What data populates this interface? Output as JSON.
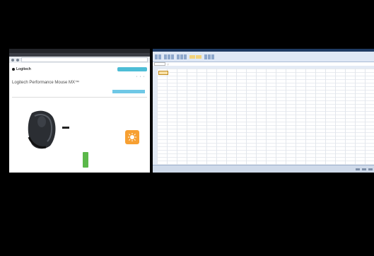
{
  "left_window": {
    "address": "",
    "site": {
      "logo_text": "Logitech",
      "nav": [
        "",
        "",
        ""
      ],
      "search_placeholder": "",
      "product_title": "Logitech Performance Mouse MX™",
      "product_sub": "",
      "cta_label": "",
      "tabs": [
        "",
        "",
        "",
        "",
        ""
      ],
      "features_title": "",
      "feature_1_head": "",
      "feature_2_head": "",
      "feature_3_head": ""
    },
    "colors": {
      "accent_blue": "#4dbdd6",
      "feature_green": "#8aa32e",
      "icon_orange": "#f7a032",
      "battery_green": "#5bb84a"
    }
  },
  "right_window": {
    "app": "spreadsheet",
    "sheet_tabs": [
      "",
      "",
      ""
    ],
    "colors": {
      "ribbon": "#dfe8f5",
      "title": "#1f3b63",
      "active_cell": "#f7e0a6"
    }
  },
  "icons": [
    "browser-back-icon",
    "browser-forward-icon",
    "mouse-product-image",
    "orange-app-icon",
    "battery-icon"
  ]
}
